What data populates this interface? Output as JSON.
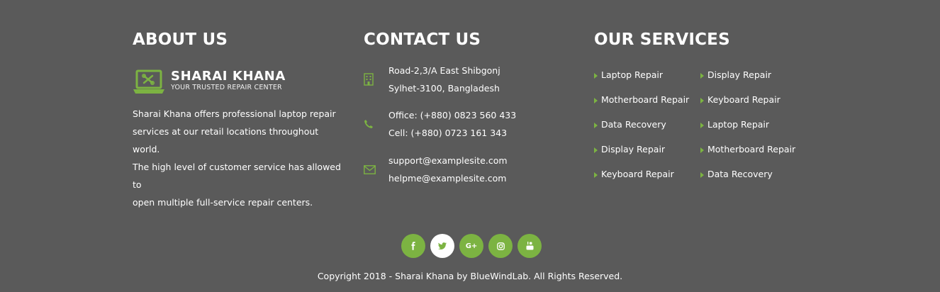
{
  "about": {
    "heading": "ABOUT US",
    "logo": {
      "name": "SHARAI KHANA",
      "tagline": "YOUR TRUSTED REPAIR CENTER",
      "icon": "laptop-wrench-icon"
    },
    "lines": [
      "Sharai Khana offers professional laptop repair",
      "services at our retail locations throughout world.",
      "The high level of customer service has allowed to",
      "open multiple full-service repair centers."
    ]
  },
  "contact": {
    "heading": "CONTACT US",
    "address": {
      "icon": "building-icon",
      "lines": [
        "Road-2,3/A East Shibgonj",
        "Sylhet-3100, Bangladesh"
      ]
    },
    "phone": {
      "icon": "phone-icon",
      "lines": [
        "Office: (+880) 0823 560 433",
        "Cell: (+880) 0723 161 343"
      ]
    },
    "email": {
      "icon": "envelope-icon",
      "lines": [
        "support@examplesite.com",
        "helpme@examplesite.com"
      ]
    }
  },
  "services": {
    "heading": "OUR SERVICES",
    "col1": [
      "Laptop Repair",
      "Motherboard Repair",
      "Data Recovery",
      "Display Repair",
      "Keyboard Repair"
    ],
    "col2": [
      "Display Repair",
      "Keyboard Repair",
      "Laptop Repair",
      "Motherboard Repair",
      "Data Recovery"
    ]
  },
  "social": [
    {
      "name": "facebook-icon",
      "glyph": "f"
    },
    {
      "name": "twitter-icon",
      "glyph": "t"
    },
    {
      "name": "google-plus-icon",
      "glyph": "G+"
    },
    {
      "name": "instagram-icon",
      "glyph": "◎"
    },
    {
      "name": "youtube-icon",
      "glyph": "▶"
    }
  ],
  "copyright": "Copyright 2018 - Sharai Khana by BlueWindLab. All Rights Reserved.",
  "colors": {
    "background": "#5a5a5a",
    "accent": "#7cb342",
    "text": "#ffffff"
  }
}
